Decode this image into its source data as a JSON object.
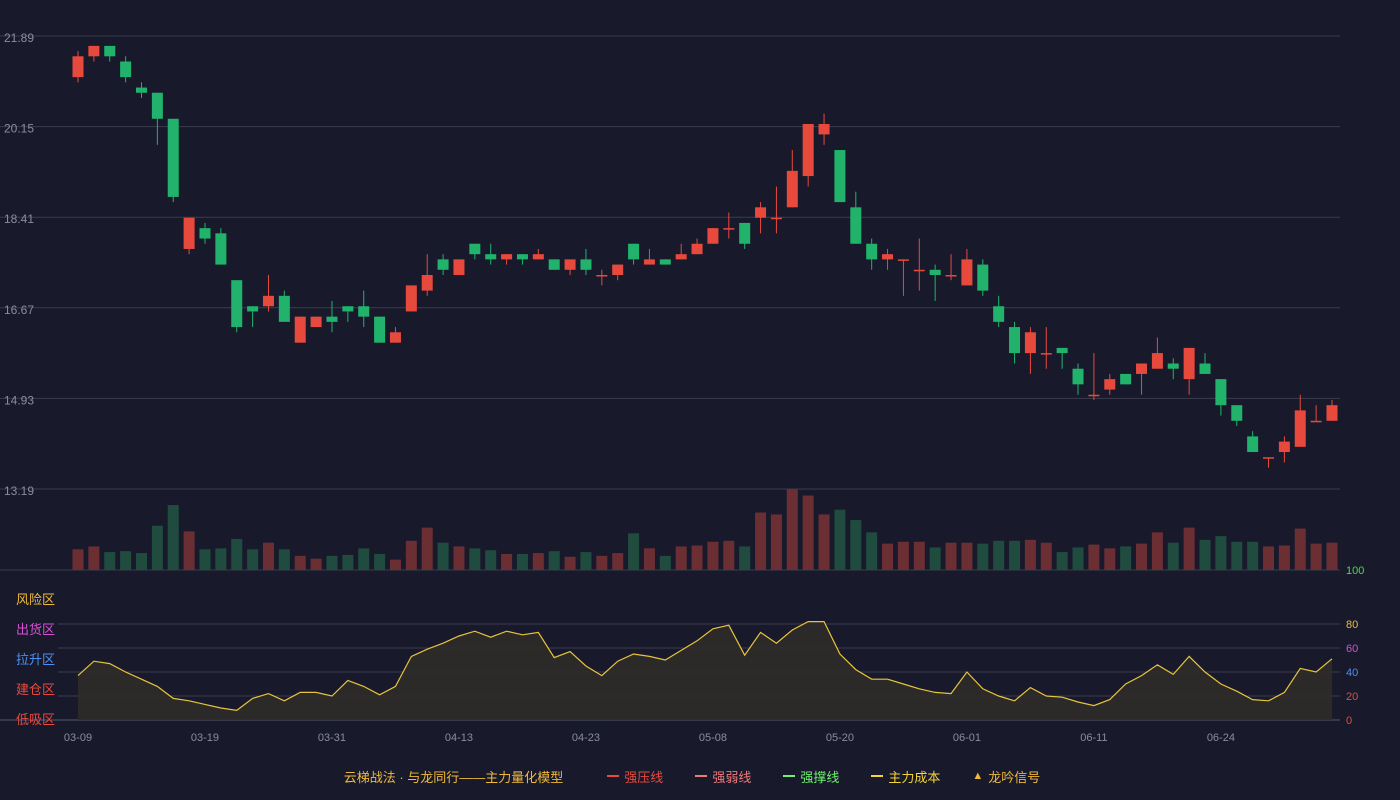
{
  "legend": {
    "title": "云梯战法 · 与龙同行——主力量化模型",
    "items": [
      {
        "label": "强压线",
        "color": "#e8493d",
        "style": "solid"
      },
      {
        "label": "强弱线",
        "color": "#f07a7a",
        "style": "dashed"
      },
      {
        "label": "强撑线",
        "color": "#6cf26c",
        "style": "solid"
      },
      {
        "label": "主力成本",
        "color": "#f2d33a",
        "style": "dashed"
      },
      {
        "label": "龙吟信号",
        "color": "#f0b93a",
        "style": "triangle"
      }
    ]
  },
  "colors": {
    "up": "#e8493d",
    "down": "#21b36b",
    "volume_up": "#6b2e33",
    "volume_down": "#1f4c3e",
    "line": "#e8c43a",
    "area": "#2f2b29",
    "grid": "#3a3c4e",
    "tick": "#8a8d99"
  },
  "chart_data": {
    "type": "candlestick",
    "price_ticks": [
      "21.89",
      "20.15",
      "18.41",
      "16.67",
      "14.93",
      "13.19"
    ],
    "price_ylim": [
      13.19,
      21.89
    ],
    "x_labels": [
      {
        "label": "03-09",
        "index": 0
      },
      {
        "label": "03-19",
        "index": 8
      },
      {
        "label": "03-31",
        "index": 16
      },
      {
        "label": "04-13",
        "index": 24
      },
      {
        "label": "04-23",
        "index": 32
      },
      {
        "label": "05-08",
        "index": 40
      },
      {
        "label": "05-20",
        "index": 48
      },
      {
        "label": "06-01",
        "index": 56
      },
      {
        "label": "06-11",
        "index": 64
      },
      {
        "label": "06-24",
        "index": 72
      }
    ],
    "ohlc": [
      [
        21.1,
        21.5,
        21.0,
        21.6
      ],
      [
        21.5,
        21.7,
        21.4,
        21.7
      ],
      [
        21.7,
        21.5,
        21.4,
        21.7
      ],
      [
        21.4,
        21.1,
        21.0,
        21.5
      ],
      [
        20.9,
        20.8,
        20.7,
        21.0
      ],
      [
        20.8,
        20.3,
        19.8,
        20.8
      ],
      [
        20.3,
        18.8,
        18.7,
        20.3
      ],
      [
        17.8,
        18.4,
        17.7,
        18.4
      ],
      [
        18.2,
        18.0,
        17.9,
        18.3
      ],
      [
        18.1,
        17.5,
        17.5,
        18.2
      ],
      [
        17.2,
        16.3,
        16.2,
        17.2
      ],
      [
        16.7,
        16.6,
        16.3,
        16.7
      ],
      [
        16.7,
        16.9,
        16.6,
        17.3
      ],
      [
        16.9,
        16.4,
        16.4,
        17.0
      ],
      [
        16.0,
        16.5,
        16.0,
        16.5
      ],
      [
        16.3,
        16.5,
        16.3,
        16.5
      ],
      [
        16.5,
        16.4,
        16.2,
        16.8
      ],
      [
        16.7,
        16.6,
        16.4,
        16.7
      ],
      [
        16.7,
        16.5,
        16.3,
        17.0
      ],
      [
        16.5,
        16.0,
        16.0,
        16.5
      ],
      [
        16.0,
        16.2,
        16.0,
        16.3
      ],
      [
        16.6,
        17.1,
        16.6,
        17.1
      ],
      [
        17.0,
        17.3,
        16.9,
        17.7
      ],
      [
        17.6,
        17.4,
        17.3,
        17.7
      ],
      [
        17.3,
        17.6,
        17.3,
        17.6
      ],
      [
        17.9,
        17.7,
        17.6,
        17.9
      ],
      [
        17.7,
        17.6,
        17.5,
        17.9
      ],
      [
        17.6,
        17.7,
        17.5,
        17.7
      ],
      [
        17.7,
        17.6,
        17.5,
        17.7
      ],
      [
        17.6,
        17.7,
        17.6,
        17.8
      ],
      [
        17.6,
        17.4,
        17.4,
        17.6
      ],
      [
        17.4,
        17.6,
        17.3,
        17.6
      ],
      [
        17.6,
        17.4,
        17.3,
        17.8
      ],
      [
        17.3,
        17.3,
        17.1,
        17.4
      ],
      [
        17.3,
        17.5,
        17.2,
        17.5
      ],
      [
        17.9,
        17.6,
        17.5,
        17.9
      ],
      [
        17.5,
        17.6,
        17.5,
        17.8
      ],
      [
        17.6,
        17.5,
        17.5,
        17.6
      ],
      [
        17.6,
        17.7,
        17.6,
        17.9
      ],
      [
        17.7,
        17.9,
        17.7,
        18.0
      ],
      [
        17.9,
        18.2,
        17.9,
        18.2
      ],
      [
        18.2,
        18.2,
        18.0,
        18.5
      ],
      [
        18.3,
        17.9,
        17.8,
        18.3
      ],
      [
        18.4,
        18.6,
        18.1,
        18.7
      ],
      [
        18.4,
        18.4,
        18.1,
        19.0
      ],
      [
        18.6,
        19.3,
        18.6,
        19.7
      ],
      [
        19.2,
        20.2,
        19.0,
        20.2
      ],
      [
        20.0,
        20.2,
        19.8,
        20.4
      ],
      [
        19.7,
        18.7,
        18.7,
        19.7
      ],
      [
        18.6,
        17.9,
        17.9,
        18.9
      ],
      [
        17.9,
        17.6,
        17.4,
        18.0
      ],
      [
        17.6,
        17.7,
        17.4,
        17.8
      ],
      [
        17.6,
        17.6,
        16.9,
        17.6
      ],
      [
        17.4,
        17.4,
        17.0,
        18.0
      ],
      [
        17.4,
        17.3,
        16.8,
        17.5
      ],
      [
        17.3,
        17.3,
        17.2,
        17.7
      ],
      [
        17.1,
        17.6,
        17.1,
        17.8
      ],
      [
        17.5,
        17.0,
        16.9,
        17.6
      ],
      [
        16.7,
        16.4,
        16.3,
        16.9
      ],
      [
        16.3,
        15.8,
        15.6,
        16.4
      ],
      [
        15.8,
        16.2,
        15.4,
        16.3
      ],
      [
        15.8,
        15.8,
        15.5,
        16.3
      ],
      [
        15.9,
        15.8,
        15.5,
        15.9
      ],
      [
        15.5,
        15.2,
        15.0,
        15.6
      ],
      [
        15.0,
        15.0,
        14.9,
        15.8
      ],
      [
        15.1,
        15.3,
        15.0,
        15.4
      ],
      [
        15.4,
        15.2,
        15.2,
        15.4
      ],
      [
        15.4,
        15.6,
        15.0,
        15.6
      ],
      [
        15.5,
        15.8,
        15.5,
        16.1
      ],
      [
        15.6,
        15.5,
        15.3,
        15.7
      ],
      [
        15.3,
        15.9,
        15.0,
        15.9
      ],
      [
        15.6,
        15.4,
        15.4,
        15.8
      ],
      [
        15.3,
        14.8,
        14.6,
        15.3
      ],
      [
        14.8,
        14.5,
        14.4,
        14.8
      ],
      [
        14.2,
        13.9,
        13.9,
        14.3
      ],
      [
        13.8,
        13.8,
        13.6,
        13.8
      ],
      [
        13.9,
        14.1,
        13.7,
        14.2
      ],
      [
        14.0,
        14.7,
        14.0,
        15.0
      ],
      [
        14.5,
        14.5,
        14.5,
        14.8
      ],
      [
        14.5,
        14.8,
        14.5,
        14.9
      ]
    ],
    "volume": [
      1.1,
      1.25,
      0.95,
      1.0,
      0.9,
      2.35,
      3.45,
      2.05,
      1.1,
      1.15,
      1.65,
      1.1,
      1.45,
      1.1,
      0.75,
      0.6,
      0.75,
      0.8,
      1.15,
      0.85,
      0.55,
      1.55,
      2.25,
      1.45,
      1.25,
      1.15,
      1.05,
      0.85,
      0.85,
      0.9,
      1.0,
      0.7,
      0.95,
      0.75,
      0.9,
      1.95,
      1.15,
      0.75,
      1.25,
      1.3,
      1.5,
      1.55,
      1.25,
      3.05,
      2.95,
      4.3,
      3.95,
      2.95,
      3.2,
      2.65,
      2.0,
      1.4,
      1.5,
      1.5,
      1.2,
      1.45,
      1.45,
      1.4,
      1.55,
      1.55,
      1.6,
      1.45,
      0.95,
      1.2,
      1.35,
      1.15,
      1.25,
      1.4,
      2.0,
      1.45,
      2.25,
      1.6,
      1.8,
      1.5,
      1.5,
      1.25,
      1.3,
      2.2,
      1.4,
      1.45
    ],
    "volume_max_label": "100",
    "indicator": {
      "zone_labels": [
        {
          "label": "风险区",
          "color": "#f0b93a"
        },
        {
          "label": "出货区",
          "color": "#d64fd6"
        },
        {
          "label": "拉升区",
          "color": "#4f8ff0"
        },
        {
          "label": "建仓区",
          "color": "#e8493d"
        },
        {
          "label": "低吸区",
          "color": "#e8493d"
        }
      ],
      "right_ticks": [
        {
          "label": "100",
          "value": 100,
          "color": "#3ce03c"
        },
        {
          "label": "80",
          "value": 80,
          "color": "#f0b93a"
        },
        {
          "label": "60",
          "value": 60,
          "color": "#d64fd6"
        },
        {
          "label": "40",
          "value": 40,
          "color": "#4f8ff0"
        },
        {
          "label": "20",
          "value": 20,
          "color": "#e8493d"
        },
        {
          "label": "0",
          "value": 0,
          "color": "#e8493d"
        }
      ],
      "ylim": [
        0,
        100
      ],
      "values": [
        37,
        49,
        47,
        40,
        34,
        28,
        18,
        16,
        13,
        10,
        8,
        18,
        22,
        16,
        23,
        23,
        20,
        33,
        28,
        21,
        28,
        53,
        59,
        64,
        70,
        74,
        69,
        74,
        71,
        73,
        52,
        57,
        45,
        37,
        49,
        55,
        53,
        50,
        58,
        66,
        76,
        79,
        54,
        73,
        64,
        75,
        82,
        82,
        55,
        42,
        34,
        34,
        30,
        26,
        23,
        22,
        40,
        26,
        20,
        16,
        27,
        20,
        19,
        15,
        12,
        17,
        30,
        37,
        46,
        38,
        53,
        40,
        30,
        24,
        17,
        16,
        23,
        43,
        40,
        51
      ]
    }
  }
}
